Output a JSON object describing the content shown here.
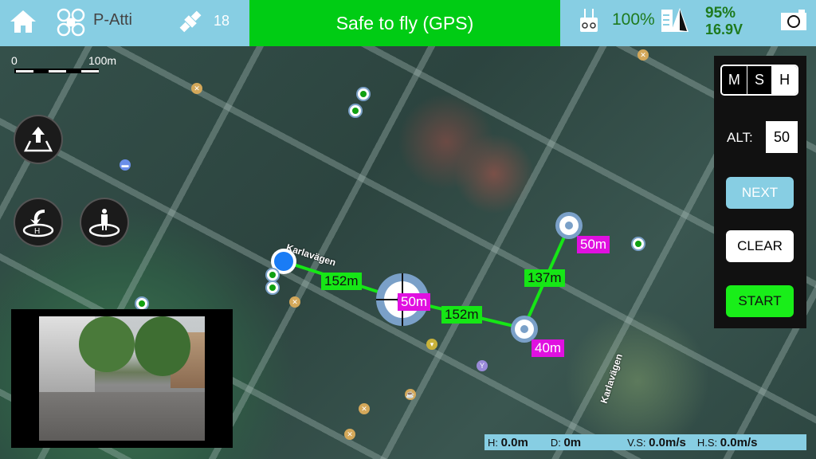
{
  "topbar": {
    "flight_mode": "P-Atti",
    "satellites": "18",
    "status": "Safe to fly (GPS)",
    "rc_signal": "100%",
    "battery_percent": "95%",
    "battery_voltage": "16.9V",
    "icons": [
      "home-icon",
      "aircraft-icon",
      "satellite-icon",
      "remote-controller-icon",
      "battery-icon",
      "compass-icon",
      "camera-icon"
    ]
  },
  "map": {
    "scale": {
      "start": "0",
      "end": "100m"
    },
    "street_labels": [
      "Karlavägen",
      "Karlavägen"
    ],
    "segments": [
      {
        "distance": "152m"
      },
      {
        "distance": "152m"
      },
      {
        "distance": "137m"
      }
    ],
    "waypoint_altitudes": [
      "50m",
      "40m",
      "50m"
    ]
  },
  "left_controls": {
    "takeoff": "takeoff-icon",
    "return_home": "return-home-icon",
    "land": "land-icon"
  },
  "panel": {
    "mode_options": [
      "M",
      "S",
      "H"
    ],
    "selected_mode": "H",
    "alt_label": "ALT:",
    "alt_value": "50",
    "next_label": "NEXT",
    "clear_label": "CLEAR",
    "start_label": "START"
  },
  "telemetry": {
    "h_label": "H:",
    "h_value": "0.0m",
    "d_label": "D:",
    "d_value": "0m",
    "vs_label": "V.S:",
    "vs_value": "0.0m/s",
    "hs_label": "H.S:",
    "hs_value": "0.0m/s"
  },
  "colors": {
    "topbar": "#87cee3",
    "status_ok": "#00cc14",
    "segment_line": "#16e616",
    "altitude_label": "#e010e0",
    "start": "#19ee19"
  }
}
